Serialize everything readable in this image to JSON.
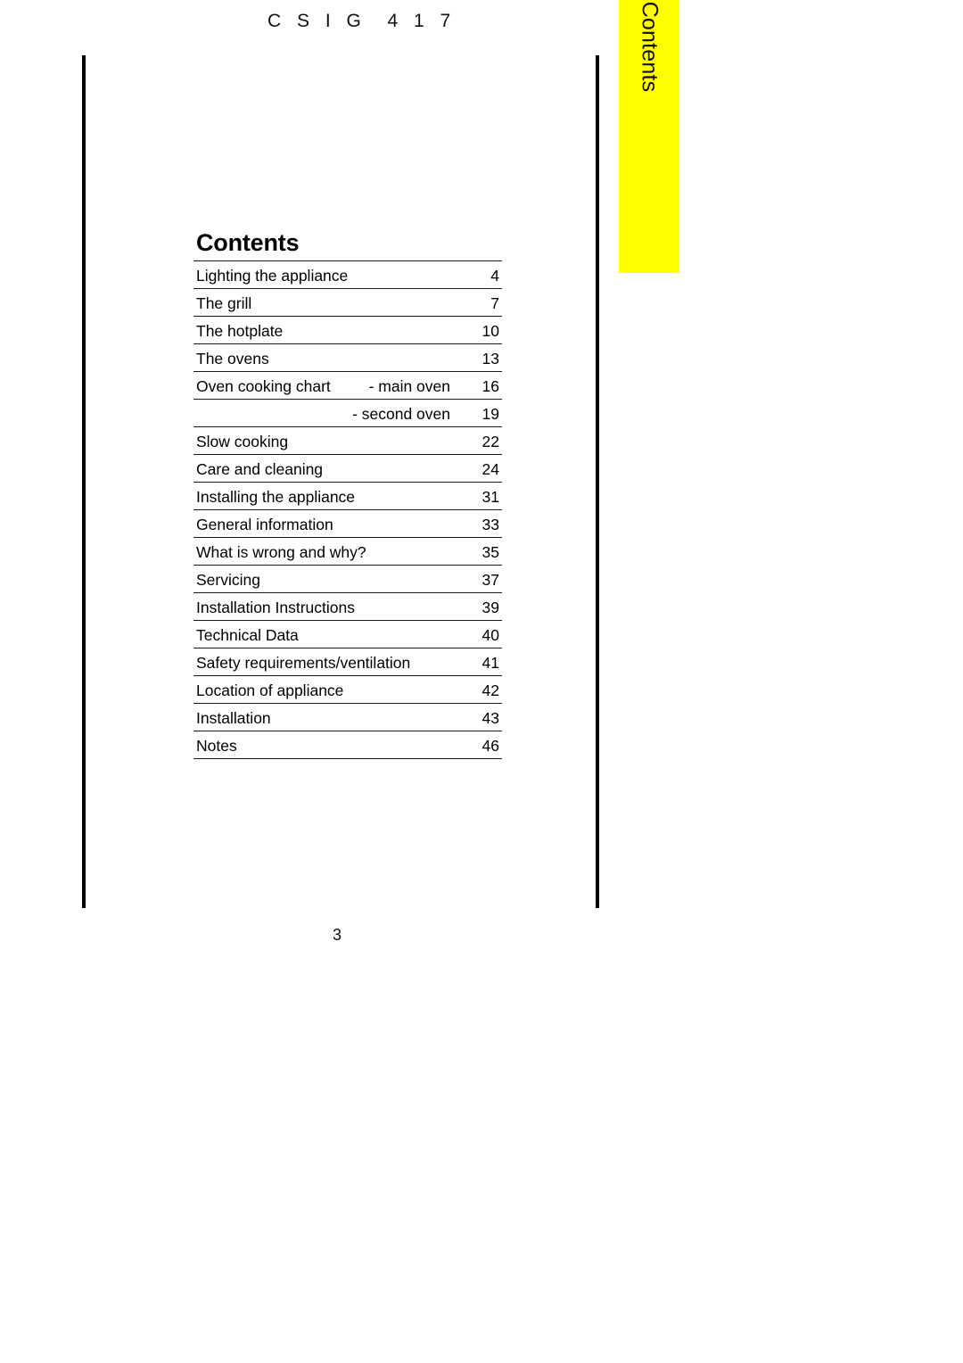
{
  "document": {
    "header_code": "C S I G  4 1 7",
    "page_number": "3"
  },
  "side_tab": {
    "label": "Contents",
    "background_color": "#ffff00",
    "text_color": "#111111"
  },
  "contents": {
    "title": "Contents",
    "entries": [
      {
        "title": "Lighting the appliance",
        "sub": "",
        "page": "4"
      },
      {
        "title": "The grill",
        "sub": "",
        "page": "7"
      },
      {
        "title": "The hotplate",
        "sub": "",
        "page": "10"
      },
      {
        "title": "The ovens",
        "sub": "",
        "page": "13"
      },
      {
        "title": "Oven cooking chart",
        "sub": "- main oven",
        "page": "16"
      },
      {
        "title": "",
        "sub": "- second oven",
        "page": "19"
      },
      {
        "title": "Slow cooking",
        "sub": "",
        "page": "22"
      },
      {
        "title": "Care and cleaning",
        "sub": "",
        "page": "24"
      },
      {
        "title": "Installing the appliance",
        "sub": "",
        "page": "31"
      },
      {
        "title": "General information",
        "sub": "",
        "page": "33"
      },
      {
        "title": "What is wrong and why?",
        "sub": "",
        "page": "35"
      },
      {
        "title": "Servicing",
        "sub": "",
        "page": "37"
      },
      {
        "title": "Installation Instructions",
        "sub": "",
        "page": "39"
      },
      {
        "title": "Technical Data",
        "sub": "",
        "page": "40"
      },
      {
        "title": "Safety requirements/ventilation",
        "sub": "",
        "page": "41"
      },
      {
        "title": "Location of appliance",
        "sub": "",
        "page": "42"
      },
      {
        "title": "Installation",
        "sub": "",
        "page": "43"
      },
      {
        "title": "Notes",
        "sub": "",
        "page": "46"
      }
    ]
  }
}
